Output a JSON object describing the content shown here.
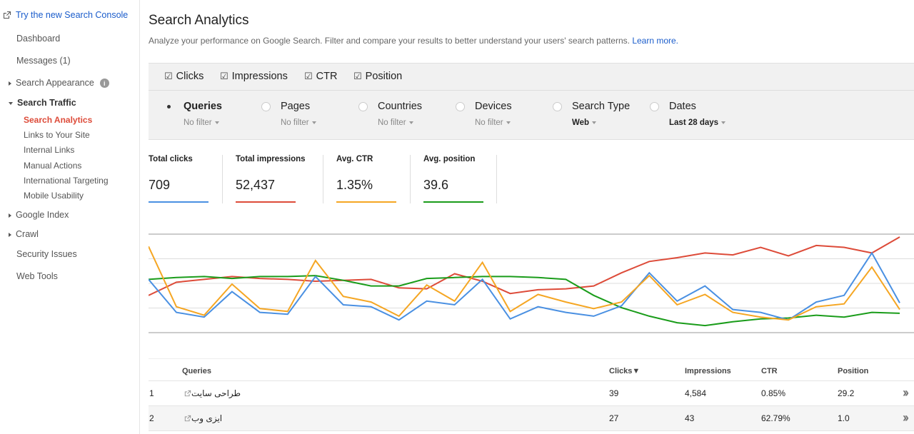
{
  "sidebar": {
    "try_new": "Try the new Search Console",
    "dashboard": "Dashboard",
    "messages": "Messages (1)",
    "search_appearance": "Search Appearance",
    "search_traffic": "Search Traffic",
    "sub_items": [
      "Search Analytics",
      "Links to Your Site",
      "Internal Links",
      "Manual Actions",
      "International Targeting",
      "Mobile Usability"
    ],
    "google_index": "Google Index",
    "crawl": "Crawl",
    "security_issues": "Security Issues",
    "web_tools": "Web Tools"
  },
  "header": {
    "title": "Search Analytics",
    "description": "Analyze your performance on Google Search. Filter and compare your results to better understand your users' search patterns.",
    "learn_more": "Learn more."
  },
  "metrics": {
    "clicks": "Clicks",
    "impressions": "Impressions",
    "ctr": "CTR",
    "position": "Position"
  },
  "groups": {
    "queries": {
      "label": "Queries",
      "filter": "No filter"
    },
    "pages": {
      "label": "Pages",
      "filter": "No filter"
    },
    "countries": {
      "label": "Countries",
      "filter": "No filter"
    },
    "devices": {
      "label": "Devices",
      "filter": "No filter"
    },
    "search_type": {
      "label": "Search Type",
      "filter": "Web"
    },
    "dates": {
      "label": "Dates",
      "filter": "Last 28 days"
    }
  },
  "totals": {
    "clicks": {
      "label": "Total clicks",
      "value": "709"
    },
    "impressions": {
      "label": "Total impressions",
      "value": "52,437"
    },
    "ctr": {
      "label": "Avg. CTR",
      "value": "1.35%"
    },
    "position": {
      "label": "Avg. position",
      "value": "39.6"
    }
  },
  "colors": {
    "clicks": "#4a90e2",
    "impressions": "#dd4b39",
    "ctr": "#f5a623",
    "position": "#1a9c1a"
  },
  "chart_data": {
    "type": "line",
    "series": [
      {
        "name": "Clicks",
        "values": [
          0.55,
          0.2,
          0.15,
          0.42,
          0.2,
          0.18,
          0.58,
          0.28,
          0.26,
          0.12,
          0.32,
          0.28,
          0.55,
          0.13,
          0.26,
          0.2,
          0.16,
          0.27,
          0.62,
          0.32,
          0.48,
          0.23,
          0.2,
          0.12,
          0.31,
          0.38,
          0.83,
          0.3
        ]
      },
      {
        "name": "Impressions",
        "values": [
          0.38,
          0.52,
          0.55,
          0.58,
          0.56,
          0.55,
          0.53,
          0.54,
          0.55,
          0.46,
          0.45,
          0.61,
          0.53,
          0.4,
          0.44,
          0.45,
          0.48,
          0.62,
          0.74,
          0.78,
          0.83,
          0.81,
          0.89,
          0.8,
          0.91,
          0.89,
          0.83,
          1.0
        ]
      },
      {
        "name": "CTR",
        "values": [
          0.9,
          0.26,
          0.17,
          0.5,
          0.24,
          0.21,
          0.75,
          0.37,
          0.31,
          0.16,
          0.49,
          0.32,
          0.73,
          0.21,
          0.39,
          0.31,
          0.24,
          0.31,
          0.59,
          0.28,
          0.39,
          0.2,
          0.15,
          0.12,
          0.26,
          0.29,
          0.68,
          0.23
        ]
      },
      {
        "name": "Position",
        "values": [
          0.55,
          0.57,
          0.58,
          0.56,
          0.58,
          0.58,
          0.59,
          0.54,
          0.48,
          0.48,
          0.56,
          0.57,
          0.58,
          0.58,
          0.57,
          0.55,
          0.38,
          0.25,
          0.16,
          0.09,
          0.06,
          0.1,
          0.13,
          0.14,
          0.17,
          0.15,
          0.2,
          0.19
        ]
      }
    ]
  },
  "table": {
    "headers": {
      "queries": "Queries",
      "clicks": "Clicks▼",
      "impressions": "Impressions",
      "ctr": "CTR",
      "position": "Position"
    },
    "rows": [
      {
        "num": "1",
        "query": "طراحی سایت",
        "clicks": "39",
        "impressions": "4,584",
        "ctr": "0.85%",
        "position": "29.2"
      },
      {
        "num": "2",
        "query": "ایزی وب",
        "clicks": "27",
        "impressions": "43",
        "ctr": "62.79%",
        "position": "1.0"
      }
    ]
  }
}
